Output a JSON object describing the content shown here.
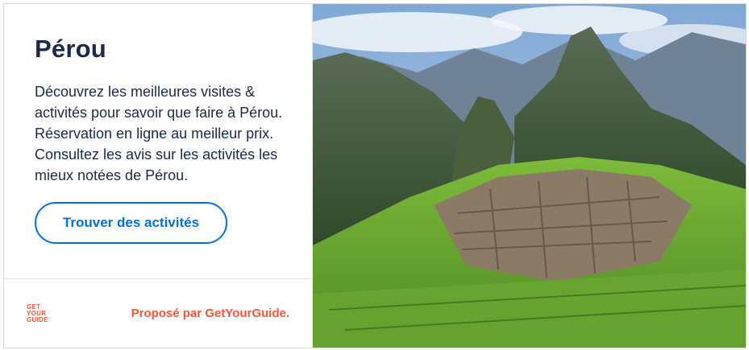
{
  "card": {
    "title": "Pérou",
    "description": "Découvrez les meilleures visites & activités pour savoir que faire à Pérou. Réservation en ligne au meilleur prix. Consultez les avis sur les activités les mieux notées de Pérou.",
    "cta_label": "Trouver des activités",
    "cta_color": "#0071eb",
    "title_color": "#1a2b49"
  },
  "footer": {
    "logo_lines": [
      "GET",
      "YOUR",
      "GUIDE"
    ],
    "powered_by": "Proposé par GetYourGuide.",
    "brand_color": "#ff5533"
  }
}
